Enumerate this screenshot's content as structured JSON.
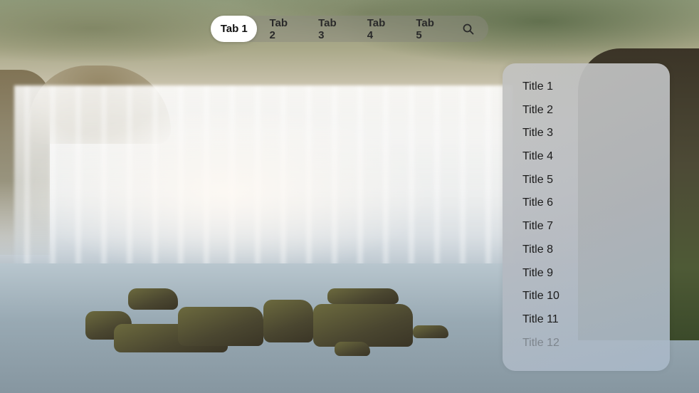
{
  "tabs": [
    {
      "label": "Tab 1",
      "active": true
    },
    {
      "label": "Tab 2",
      "active": false
    },
    {
      "label": "Tab 3",
      "active": false
    },
    {
      "label": "Tab 4",
      "active": false
    },
    {
      "label": "Tab 5",
      "active": false
    }
  ],
  "search": {
    "icon": "search-icon"
  },
  "list": {
    "items": [
      "Title 1",
      "Title 2",
      "Title 3",
      "Title 4",
      "Title 5",
      "Title 6",
      "Title 7",
      "Title 8",
      "Title 9",
      "Title 10",
      "Title 11",
      "Title 12"
    ]
  },
  "colors": {
    "active_tab_bg": "#ffffff",
    "tab_text": "#2a2a2a",
    "list_text": "#1c1c1c"
  }
}
